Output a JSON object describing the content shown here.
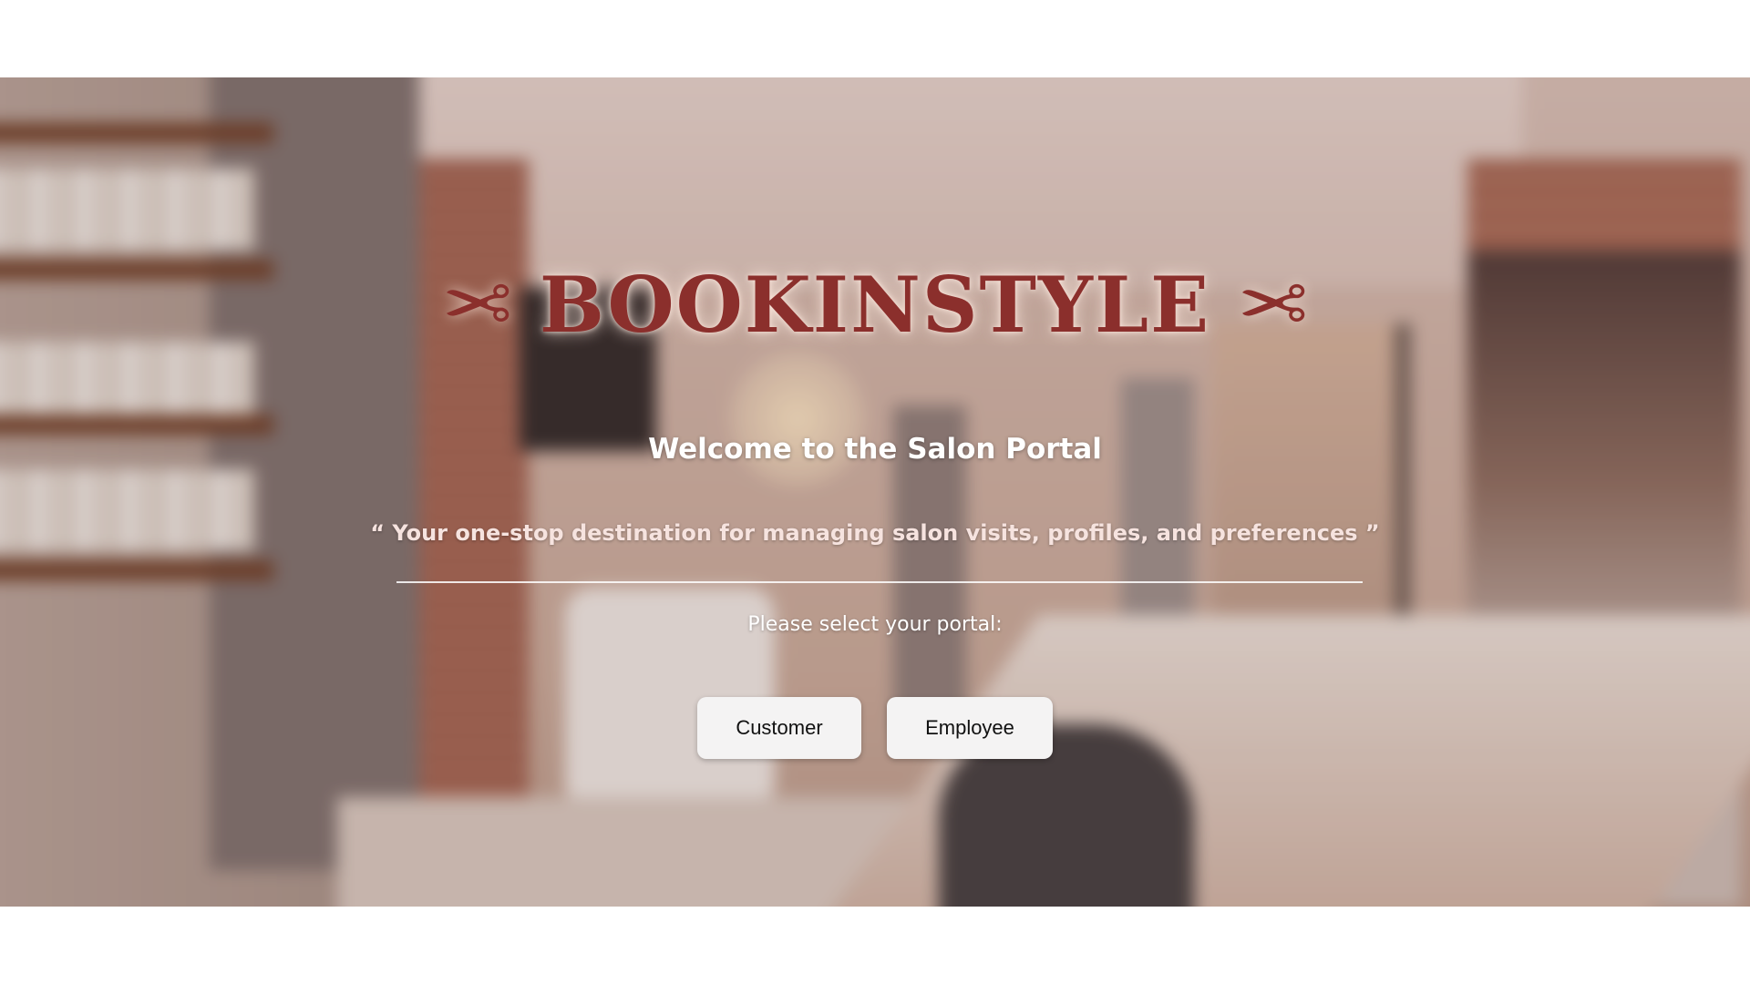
{
  "brand": {
    "title": "BOOKINSTYLE",
    "icon_left": "scissors-icon",
    "icon_right": "scissors-icon",
    "color": "#8b2f2c"
  },
  "hero": {
    "welcome": "Welcome to the Salon Portal",
    "tagline": "“ Your one-stop destination for managing salon visits, profiles, and preferences ”",
    "prompt": "Please select your portal:"
  },
  "portals": {
    "customer_label": "Customer",
    "employee_label": "Employee"
  }
}
